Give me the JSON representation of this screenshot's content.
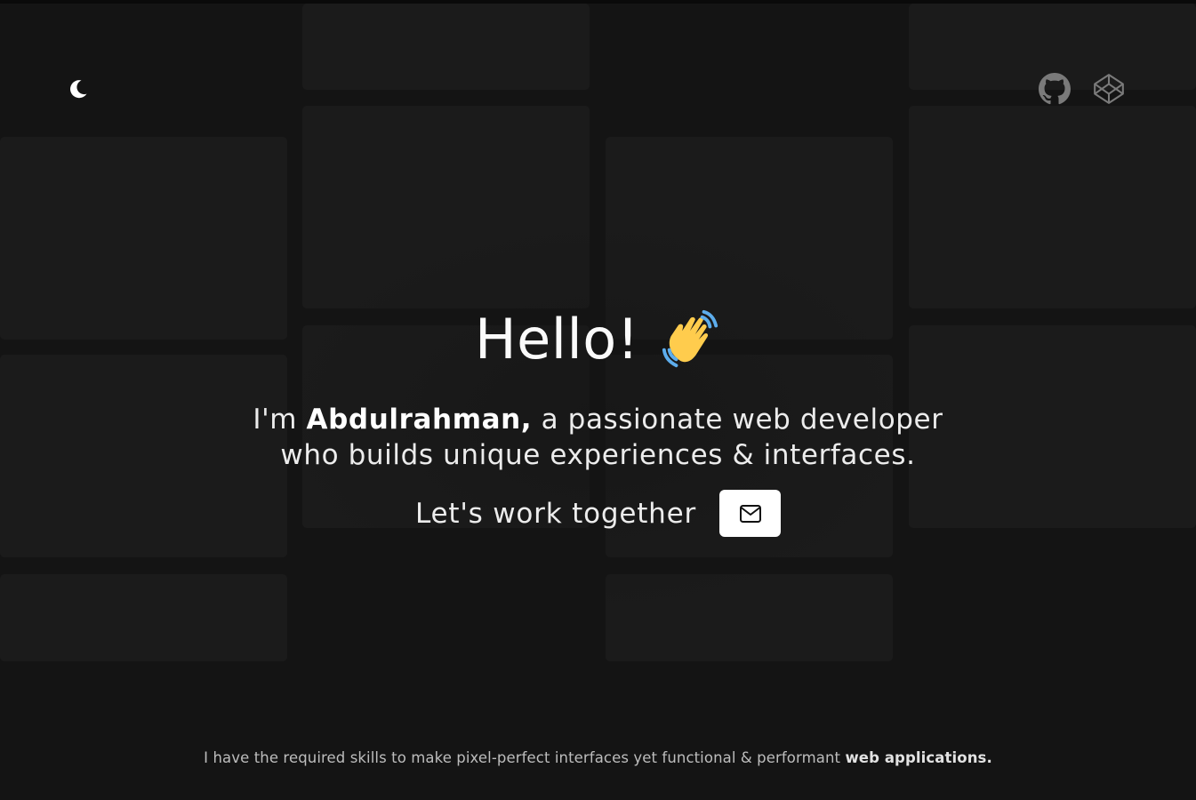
{
  "header": {
    "theme_icon": "moon-icon",
    "social": [
      {
        "name": "GitHub",
        "icon": "github-icon"
      },
      {
        "name": "CodePen",
        "icon": "codepen-icon"
      }
    ]
  },
  "hero": {
    "greeting": "Hello!",
    "wave_icon": "waving-hand-icon",
    "intro_prefix": "I'm ",
    "name": "Abdulrahman,",
    "intro_line1_suffix": " a passionate web developer",
    "intro_line2": "who builds unique experiences & interfaces.",
    "cta_text": "Let's work together",
    "cta_icon": "mail-icon"
  },
  "footer": {
    "text": "I have the required skills to make pixel-perfect interfaces yet functional & performant ",
    "highlight": "web applications."
  },
  "colors": {
    "background": "#141414",
    "tile": "#1b1b1b",
    "text": "#ececec",
    "button": "#ffffff",
    "wave_yellow": "#ffcc4d",
    "wave_blue": "#5dadec"
  }
}
